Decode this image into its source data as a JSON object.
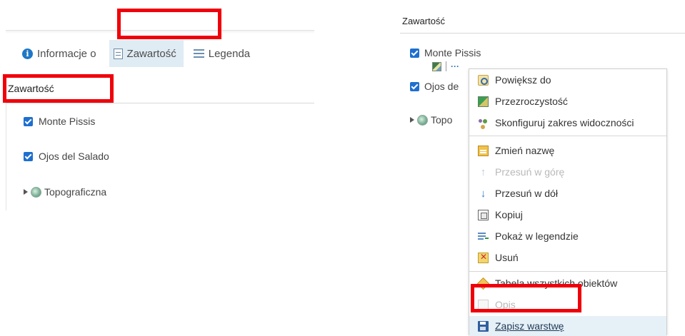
{
  "left": {
    "tabs": [
      {
        "label": "Informacje o",
        "icon": "info-icon"
      },
      {
        "label": "Zawartość",
        "icon": "document-icon"
      },
      {
        "label": "Legenda",
        "icon": "legend-icon"
      }
    ],
    "section_title": "Zawartość",
    "layers": [
      "Monte Pissis",
      "Ojos del Salado"
    ],
    "basemap": "Topograficzna"
  },
  "right": {
    "section_title": "Zawartość",
    "layers": [
      "Monte Pissis",
      "Ojos de",
      "Topo"
    ],
    "menu": {
      "items": [
        {
          "label": "Powiększ do",
          "icon": "zoom-to-icon",
          "disabled": false
        },
        {
          "label": "Przezroczystość",
          "icon": "transparency-icon",
          "disabled": false
        },
        {
          "label": "Skonfiguruj zakres widoczności",
          "icon": "visibility-range-icon",
          "disabled": false
        },
        {
          "label": "Zmień nazwę",
          "icon": "rename-icon",
          "disabled": false
        },
        {
          "label": "Przesuń w górę",
          "icon": "arrow-up-icon",
          "disabled": true
        },
        {
          "label": "Przesuń w dół",
          "icon": "arrow-down-icon",
          "disabled": false
        },
        {
          "label": "Kopiuj",
          "icon": "copy-icon",
          "disabled": false
        },
        {
          "label": "Pokaż w legendzie",
          "icon": "show-legend-icon",
          "disabled": false
        },
        {
          "label": "Usuń",
          "icon": "delete-icon",
          "disabled": false
        },
        {
          "label": "Tabela wszystkich obiektów",
          "icon": "attribute-table-icon",
          "disabled": false
        },
        {
          "label": "Opis",
          "icon": "description-icon",
          "disabled": true
        },
        {
          "label": "Zapisz warstwę",
          "icon": "save-layer-icon",
          "disabled": false
        }
      ]
    }
  },
  "colors": {
    "annotation_red": "#f0000a",
    "checkbox_blue": "#1e6fd0",
    "active_tab_bg": "#e0ecf4",
    "menu_highlight": "#e6f0f7"
  }
}
